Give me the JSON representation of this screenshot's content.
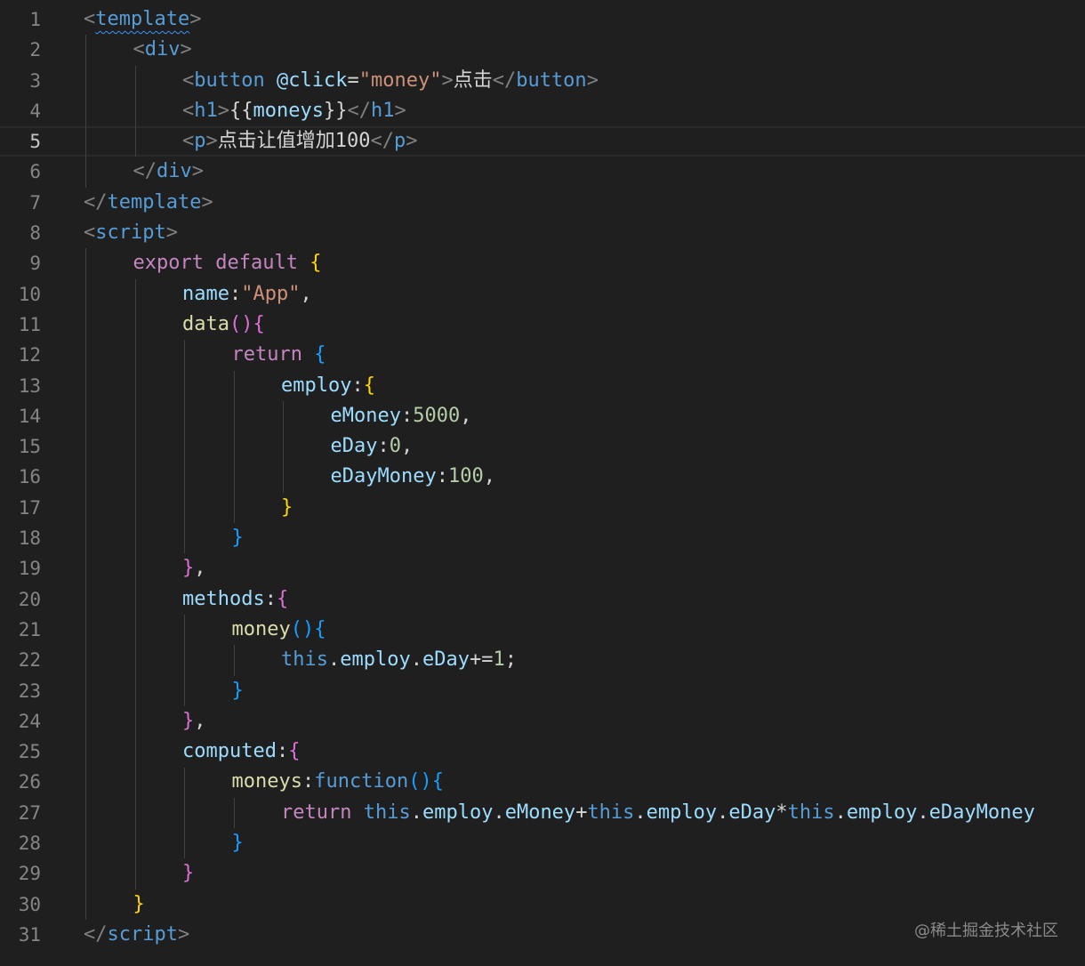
{
  "colors": {
    "background": "#1f1f1f",
    "line_number": "#858585",
    "tag_bracket": "#808080",
    "tag_name": "#569cd6",
    "attribute": "#9cdcfe",
    "string": "#ce9178",
    "text": "#d4d4d4",
    "keyword_control": "#c586c0",
    "keyword": "#569cd6",
    "function": "#dcdcaa",
    "number": "#b5cea8",
    "bracket_gold": "#ffd700",
    "bracket_pink": "#da70d6",
    "bracket_blue": "#179fff"
  },
  "editor": {
    "current_line": 5,
    "lines": [
      {
        "n": "1",
        "indent": 0,
        "tokens": [
          [
            "<",
            "tag_bracket"
          ],
          [
            "template",
            "tag_name_squiggle"
          ],
          [
            ">",
            "tag_bracket"
          ]
        ]
      },
      {
        "n": "2",
        "indent": 1,
        "tokens": [
          [
            "<",
            "tag_bracket"
          ],
          [
            "div",
            "tag_name"
          ],
          [
            ">",
            "tag_bracket"
          ]
        ]
      },
      {
        "n": "3",
        "indent": 2,
        "tokens": [
          [
            "<",
            "tag_bracket"
          ],
          [
            "button",
            "tag_name"
          ],
          [
            " ",
            "text"
          ],
          [
            "@click",
            "attribute"
          ],
          [
            "=",
            "text"
          ],
          [
            "\"money\"",
            "string"
          ],
          [
            ">",
            "tag_bracket"
          ],
          [
            "点击",
            "text"
          ],
          [
            "</",
            "tag_bracket"
          ],
          [
            "button",
            "tag_name"
          ],
          [
            ">",
            "tag_bracket"
          ]
        ]
      },
      {
        "n": "4",
        "indent": 2,
        "tokens": [
          [
            "<",
            "tag_bracket"
          ],
          [
            "h1",
            "tag_name"
          ],
          [
            ">",
            "tag_bracket"
          ],
          [
            "{{",
            "text"
          ],
          [
            "moneys",
            "attribute"
          ],
          [
            "}}",
            "text"
          ],
          [
            "</",
            "tag_bracket"
          ],
          [
            "h1",
            "tag_name"
          ],
          [
            ">",
            "tag_bracket"
          ]
        ]
      },
      {
        "n": "5",
        "indent": 2,
        "tokens": [
          [
            "<",
            "tag_bracket"
          ],
          [
            "p",
            "tag_name"
          ],
          [
            ">",
            "tag_bracket"
          ],
          [
            "点击让值增加100",
            "text"
          ],
          [
            "</",
            "tag_bracket"
          ],
          [
            "p",
            "tag_name"
          ],
          [
            ">",
            "tag_bracket"
          ]
        ]
      },
      {
        "n": "6",
        "indent": 1,
        "tokens": [
          [
            "</",
            "tag_bracket"
          ],
          [
            "div",
            "tag_name"
          ],
          [
            ">",
            "tag_bracket"
          ]
        ]
      },
      {
        "n": "7",
        "indent": 0,
        "tokens": [
          [
            "</",
            "tag_bracket"
          ],
          [
            "template",
            "tag_name"
          ],
          [
            ">",
            "tag_bracket"
          ]
        ]
      },
      {
        "n": "8",
        "indent": 0,
        "tokens": [
          [
            "<",
            "tag_bracket"
          ],
          [
            "script",
            "tag_name"
          ],
          [
            ">",
            "tag_bracket"
          ]
        ]
      },
      {
        "n": "9",
        "indent": 1,
        "tokens": [
          [
            "export",
            "keyword_control"
          ],
          [
            " ",
            "text"
          ],
          [
            "default",
            "keyword_control"
          ],
          [
            " ",
            "text"
          ],
          [
            "{",
            "bracket_gold"
          ]
        ]
      },
      {
        "n": "10",
        "indent": 2,
        "tokens": [
          [
            "name",
            "attribute"
          ],
          [
            ":",
            "text"
          ],
          [
            "\"App\"",
            "string"
          ],
          [
            ",",
            "text"
          ]
        ]
      },
      {
        "n": "11",
        "indent": 2,
        "tokens": [
          [
            "data",
            "function"
          ],
          [
            "()",
            "bracket_pink"
          ],
          [
            "{",
            "bracket_pink"
          ]
        ]
      },
      {
        "n": "12",
        "indent": 3,
        "tokens": [
          [
            "return",
            "keyword_control"
          ],
          [
            " ",
            "text"
          ],
          [
            "{",
            "bracket_blue"
          ]
        ]
      },
      {
        "n": "13",
        "indent": 4,
        "tokens": [
          [
            "employ",
            "attribute"
          ],
          [
            ":",
            "text"
          ],
          [
            "{",
            "bracket_gold"
          ]
        ]
      },
      {
        "n": "14",
        "indent": 5,
        "tokens": [
          [
            "eMoney",
            "attribute"
          ],
          [
            ":",
            "text"
          ],
          [
            "5000",
            "number"
          ],
          [
            ",",
            "text"
          ]
        ]
      },
      {
        "n": "15",
        "indent": 5,
        "tokens": [
          [
            "eDay",
            "attribute"
          ],
          [
            ":",
            "text"
          ],
          [
            "0",
            "number"
          ],
          [
            ",",
            "text"
          ]
        ]
      },
      {
        "n": "16",
        "indent": 5,
        "tokens": [
          [
            "eDayMoney",
            "attribute"
          ],
          [
            ":",
            "text"
          ],
          [
            "100",
            "number"
          ],
          [
            ",",
            "text"
          ]
        ]
      },
      {
        "n": "17",
        "indent": 4,
        "tokens": [
          [
            "}",
            "bracket_gold"
          ]
        ]
      },
      {
        "n": "18",
        "indent": 3,
        "tokens": [
          [
            "}",
            "bracket_blue"
          ]
        ]
      },
      {
        "n": "19",
        "indent": 2,
        "tokens": [
          [
            "}",
            "bracket_pink"
          ],
          [
            ",",
            "text"
          ]
        ]
      },
      {
        "n": "20",
        "indent": 2,
        "tokens": [
          [
            "methods",
            "attribute"
          ],
          [
            ":",
            "text"
          ],
          [
            "{",
            "bracket_pink"
          ]
        ]
      },
      {
        "n": "21",
        "indent": 3,
        "tokens": [
          [
            "money",
            "function"
          ],
          [
            "()",
            "bracket_blue"
          ],
          [
            "{",
            "bracket_blue"
          ]
        ]
      },
      {
        "n": "22",
        "indent": 4,
        "tokens": [
          [
            "this",
            "keyword"
          ],
          [
            ".",
            "text"
          ],
          [
            "employ",
            "attribute"
          ],
          [
            ".",
            "text"
          ],
          [
            "eDay",
            "attribute"
          ],
          [
            "+=",
            "text"
          ],
          [
            "1",
            "number"
          ],
          [
            ";",
            "text"
          ]
        ]
      },
      {
        "n": "23",
        "indent": 3,
        "tokens": [
          [
            "}",
            "bracket_blue"
          ]
        ]
      },
      {
        "n": "24",
        "indent": 2,
        "tokens": [
          [
            "}",
            "bracket_pink"
          ],
          [
            ",",
            "text"
          ]
        ]
      },
      {
        "n": "25",
        "indent": 2,
        "tokens": [
          [
            "computed",
            "attribute"
          ],
          [
            ":",
            "text"
          ],
          [
            "{",
            "bracket_pink"
          ]
        ]
      },
      {
        "n": "26",
        "indent": 3,
        "tokens": [
          [
            "moneys",
            "function"
          ],
          [
            ":",
            "text"
          ],
          [
            "function",
            "keyword"
          ],
          [
            "()",
            "bracket_blue"
          ],
          [
            "{",
            "bracket_blue"
          ]
        ]
      },
      {
        "n": "27",
        "indent": 4,
        "tokens": [
          [
            "return",
            "keyword_control"
          ],
          [
            " ",
            "text"
          ],
          [
            "this",
            "keyword"
          ],
          [
            ".",
            "text"
          ],
          [
            "employ",
            "attribute"
          ],
          [
            ".",
            "text"
          ],
          [
            "eMoney",
            "attribute"
          ],
          [
            "+",
            "text"
          ],
          [
            "this",
            "keyword"
          ],
          [
            ".",
            "text"
          ],
          [
            "employ",
            "attribute"
          ],
          [
            ".",
            "text"
          ],
          [
            "eDay",
            "attribute"
          ],
          [
            "*",
            "text"
          ],
          [
            "this",
            "keyword"
          ],
          [
            ".",
            "text"
          ],
          [
            "employ",
            "attribute"
          ],
          [
            ".",
            "text"
          ],
          [
            "eDayMoney",
            "attribute"
          ]
        ]
      },
      {
        "n": "28",
        "indent": 3,
        "tokens": [
          [
            "}",
            "bracket_blue"
          ]
        ]
      },
      {
        "n": "29",
        "indent": 2,
        "tokens": [
          [
            "}",
            "bracket_pink"
          ]
        ]
      },
      {
        "n": "30",
        "indent": 1,
        "tokens": [
          [
            "}",
            "bracket_gold"
          ]
        ]
      },
      {
        "n": "31",
        "indent": 0,
        "tokens": [
          [
            "</",
            "tag_bracket"
          ],
          [
            "script",
            "tag_name"
          ],
          [
            ">",
            "tag_bracket"
          ]
        ]
      }
    ]
  },
  "watermark": "@稀土掘金技术社区"
}
